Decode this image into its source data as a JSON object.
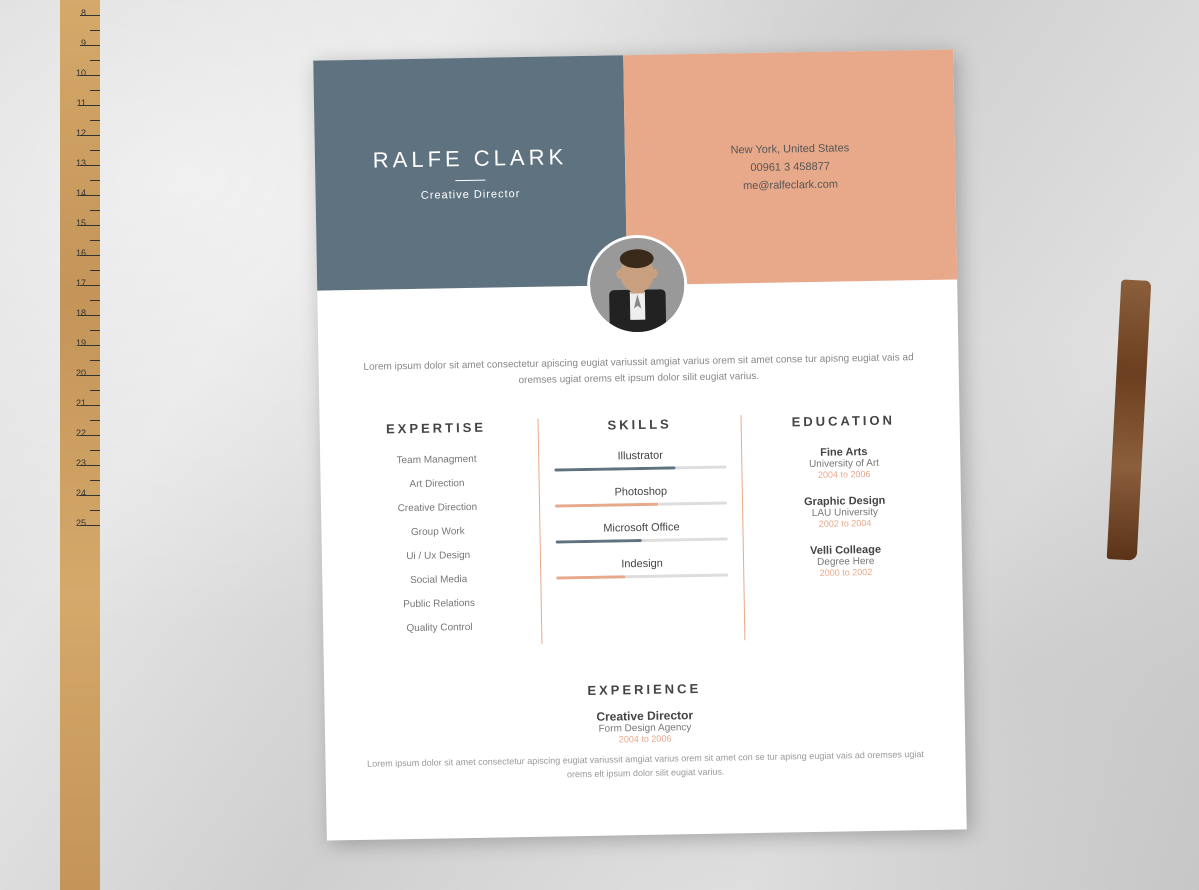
{
  "colors": {
    "header_left_bg": "#5f7280",
    "header_right_bg": "#e8a98a",
    "accent_peach": "#e8a98a",
    "accent_dark": "#5f7280",
    "text_dark": "#444",
    "text_medium": "#777",
    "text_light": "#999"
  },
  "header": {
    "name": "RALFE  CLARK",
    "title": "Creative Director",
    "location": "New York, United States",
    "phone": "00961 3 458877",
    "email": "me@ralfeclark.com"
  },
  "bio": "Lorem ipsum dolor sit amet consectetur apiscing eugiat variussit amgiat varius orem sit amet conse tur apisng eugiat vais ad oremses ugiat orems elt ipsum dolor silit eugiat varius.",
  "expertise": {
    "heading": "EXPERTISE",
    "items": [
      "Team Managment",
      "Art Direction",
      "Creative Direction",
      "Group Work",
      "Ui / Ux Design",
      "Social Media",
      "Public Relations",
      "Quality Control"
    ]
  },
  "skills": {
    "heading": "SKILLS",
    "items": [
      {
        "name": "Illustrator",
        "fill": 70,
        "color": "dark"
      },
      {
        "name": "Photoshop",
        "fill": 60,
        "color": "peach"
      },
      {
        "name": "Microsoft Office",
        "fill": 50,
        "color": "dark"
      },
      {
        "name": "Indesign",
        "fill": 40,
        "color": "peach"
      }
    ]
  },
  "education": {
    "heading": "EDUCATION",
    "items": [
      {
        "degree": "Fine Arts",
        "school": "University of Art",
        "year": "2004 to 2006"
      },
      {
        "degree": "Graphic Design",
        "school": "LAU University",
        "year": "2002 to 2004"
      },
      {
        "degree": "Velli Colleage",
        "school": "Degree Here",
        "year": "2000 to 2002"
      }
    ]
  },
  "experience": {
    "heading": "EXPERIENCE",
    "items": [
      {
        "title": "Creative Director",
        "company": "Form Design Agency",
        "year": "2004 to 2006",
        "bio": "Lorem ipsum dolor sit amet consectetur apiscing eugiat variussit amgiat varius orem sit amet con se tur apisng eugiat vais ad oremses ugiat orems elt ipsum dolor silit eugiat varius."
      }
    ]
  }
}
